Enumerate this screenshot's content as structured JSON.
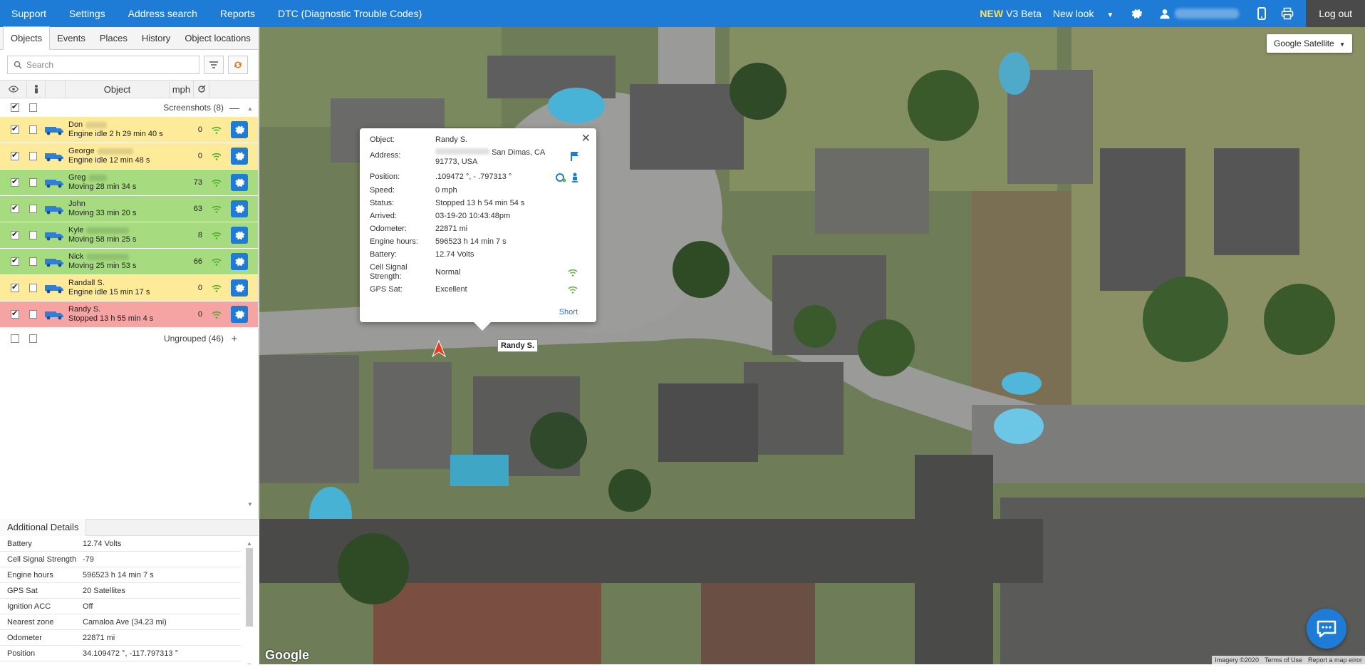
{
  "nav": {
    "items": [
      "Support",
      "Settings",
      "Address search",
      "Reports",
      "DTC (Diagnostic Trouble Codes)"
    ],
    "new_label": "NEW",
    "beta_label": "V3 Beta",
    "new_look_label": "New look",
    "logout_label": "Log out"
  },
  "tabs": [
    "Objects",
    "Events",
    "Places",
    "History",
    "Object locations"
  ],
  "search": {
    "placeholder": "Search"
  },
  "grid": {
    "object_header": "Object",
    "speed_header": "mph"
  },
  "groups": {
    "screenshots": "Screenshots (8)",
    "ungrouped": "Ungrouped (46)"
  },
  "objects": [
    {
      "name": "Don",
      "status": "Engine idle 2 h 29 min 40 s",
      "speed": "0",
      "color": "#fdeb9a"
    },
    {
      "name": "George",
      "status": "Engine idle 12 min 48 s",
      "speed": "0",
      "color": "#fdeb9a"
    },
    {
      "name": "Greg",
      "status": "Moving 28 min 34 s",
      "speed": "73",
      "color": "#a6dc7f"
    },
    {
      "name": "John",
      "status": "Moving 33 min 20 s",
      "speed": "63",
      "color": "#a6dc7f"
    },
    {
      "name": "Kyle",
      "status": "Moving 58 min 25 s",
      "speed": "8",
      "color": "#a6dc7f"
    },
    {
      "name": "Nick",
      "status": "Moving 25 min 53 s",
      "speed": "66",
      "color": "#a6dc7f"
    },
    {
      "name": "Randall S.",
      "status": "Engine idle 15 min 17 s",
      "speed": "0",
      "color": "#fdeb9a"
    },
    {
      "name": "Randy S.",
      "status": "Stopped 13 h 55 min 4 s",
      "speed": "0",
      "color": "#f6a3a3"
    }
  ],
  "details": {
    "title": "Additional Details",
    "rows": [
      {
        "k": "Battery",
        "v": "12.74 Volts"
      },
      {
        "k": "Cell Signal Strength",
        "v": "-79"
      },
      {
        "k": "Engine hours",
        "v": "596523 h 14 min 7 s"
      },
      {
        "k": "GPS Sat",
        "v": "20 Satellites"
      },
      {
        "k": "Ignition ACC",
        "v": "Off"
      },
      {
        "k": "Nearest zone",
        "v": "Camaloa Ave (34.23 mi)"
      },
      {
        "k": "Odometer",
        "v": "22871 mi"
      },
      {
        "k": "Position",
        "v": "34.109472 °, -117.797313 °"
      }
    ]
  },
  "map": {
    "type_label": "Google Satellite",
    "vehicle_label": "Randy S.",
    "google_label": "Google",
    "attribution": [
      "Imagery ©2020",
      "Terms of Use",
      "Report a map error"
    ]
  },
  "popup": {
    "object_k": "Object:",
    "object_v": "Randy S.",
    "address_k": "Address:",
    "address_v1": "San Dimas, CA",
    "address_v2": "91773, USA",
    "position_k": "Position:",
    "position_v": ".109472 °, - .797313 °",
    "speed_k": "Speed:",
    "speed_v": "0 mph",
    "status_k": "Status:",
    "status_v": "Stopped 13 h 54 min 54 s",
    "arrived_k": "Arrived:",
    "arrived_v": "03-19-20 10:43:48pm",
    "odometer_k": "Odometer:",
    "odometer_v": "22871 mi",
    "engine_k": "Engine hours:",
    "engine_v": "596523 h 14 min 7 s",
    "battery_k": "Battery:",
    "battery_v": "12.74 Volts",
    "cell_k": "Cell Signal Strength:",
    "cell_v": "Normal",
    "gps_k": "GPS Sat:",
    "gps_v": "Excellent",
    "short_label": "Short"
  }
}
